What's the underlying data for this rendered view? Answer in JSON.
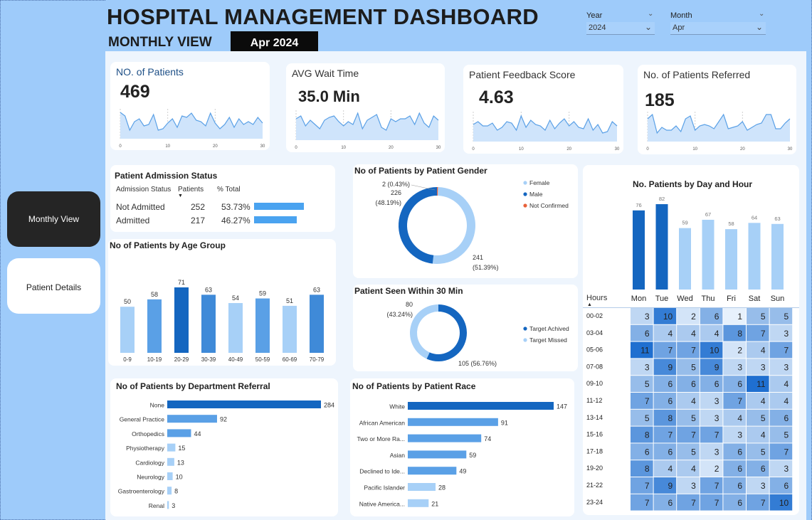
{
  "header": {
    "title": "HOSPITAL MANAGEMENT DASHBOARD",
    "subtitle": "MONTHLY VIEW",
    "selected_period": "Apr 2024"
  },
  "slicers": {
    "year": {
      "label": "Year",
      "value": "2024"
    },
    "month": {
      "label": "Month",
      "value": "Apr"
    }
  },
  "nav": {
    "monthly": "Monthly View",
    "patient": "Patient Details"
  },
  "kpis": [
    {
      "title": "NO. of Patients",
      "value": "469",
      "ticks": [
        "0",
        "10",
        "20",
        "30"
      ]
    },
    {
      "title": "AVG Wait Time",
      "value": "35.0 Min",
      "ticks": [
        "0",
        "10",
        "20",
        "30"
      ]
    },
    {
      "title": "Patient Feedback Score",
      "value": "4.63",
      "ticks": [
        "0",
        "10",
        "20",
        "30"
      ]
    },
    {
      "title": "No. of Patients Referred",
      "value": "185",
      "ticks": [
        "0",
        "10",
        "20",
        "30"
      ]
    }
  ],
  "admission": {
    "title": "Patient Admission Status",
    "headers": [
      "Admission Status",
      "Patients",
      "% Total"
    ],
    "rows": [
      {
        "status": "Not Admitted",
        "patients": "252",
        "pct": "53.73%",
        "share": 53.73
      },
      {
        "status": "Admitted",
        "patients": "217",
        "pct": "46.27%",
        "share": 46.27
      }
    ]
  },
  "colors": {
    "dark": "#1466c0",
    "mid": "#5aa0e6",
    "light": "#a7d0f7",
    "orange": "#e8613a",
    "heat_max": "#1f6fd0",
    "heat_min": "#e7f1fc"
  },
  "chart_data": [
    {
      "type": "bar",
      "title": "No of Patients by Age Group",
      "categories": [
        "0-9",
        "10-19",
        "20-29",
        "30-39",
        "40-49",
        "50-59",
        "60-69",
        "70-79"
      ],
      "values": [
        50,
        58,
        71,
        63,
        54,
        59,
        51,
        63
      ]
    },
    {
      "type": "pie",
      "title": "No of Patients by Patient Gender",
      "labels": [
        "Female",
        "Male",
        "Not Confirmed"
      ],
      "values": [
        241,
        226,
        2
      ],
      "data_labels": [
        "241\n(51.39%)",
        "226\n(48.19%)",
        "2 (0.43%)"
      ]
    },
    {
      "type": "pie",
      "title": "Patient Seen Within 30 Min",
      "labels": [
        "Target Achived",
        "Target Missed"
      ],
      "values": [
        105,
        80
      ],
      "data_labels": [
        "105 (56.76%)",
        "80\n(43.24%)"
      ]
    },
    {
      "type": "bar",
      "title": "No. Patients by Day and Hour",
      "categories": [
        "Mon",
        "Tue",
        "Wed",
        "Thu",
        "Fri",
        "Sat",
        "Sun"
      ],
      "values": [
        76,
        82,
        59,
        67,
        58,
        64,
        63
      ]
    },
    {
      "type": "heatmap",
      "row_header": "Hours",
      "rows": [
        "00-02",
        "03-04",
        "05-06",
        "07-08",
        "09-10",
        "11-12",
        "13-14",
        "15-16",
        "17-18",
        "19-20",
        "21-22",
        "23-24"
      ],
      "columns": [
        "Mon",
        "Tue",
        "Wed",
        "Thu",
        "Fri",
        "Sat",
        "Sun"
      ],
      "values": [
        [
          3,
          10,
          2,
          6,
          1,
          5,
          5
        ],
        [
          6,
          4,
          4,
          4,
          8,
          7,
          3
        ],
        [
          11,
          7,
          7,
          10,
          2,
          4,
          7
        ],
        [
          3,
          9,
          5,
          9,
          3,
          3,
          3
        ],
        [
          5,
          6,
          6,
          6,
          6,
          11,
          4
        ],
        [
          7,
          6,
          4,
          3,
          7,
          4,
          4
        ],
        [
          5,
          8,
          5,
          3,
          4,
          5,
          6
        ],
        [
          8,
          7,
          7,
          7,
          3,
          4,
          5
        ],
        [
          6,
          6,
          5,
          3,
          6,
          5,
          7
        ],
        [
          8,
          4,
          4,
          2,
          6,
          6,
          3
        ],
        [
          7,
          9,
          3,
          7,
          6,
          3,
          6
        ],
        [
          7,
          6,
          7,
          7,
          6,
          7,
          10
        ]
      ]
    },
    {
      "type": "bar",
      "orientation": "horizontal",
      "title": "No of Patients by Department Referral",
      "categories": [
        "None",
        "General Practice",
        "Orthopedics",
        "Physiotherapy",
        "Cardiology",
        "Neurology",
        "Gastroenterology",
        "Renal"
      ],
      "values": [
        284,
        92,
        44,
        15,
        13,
        10,
        8,
        3
      ]
    },
    {
      "type": "bar",
      "orientation": "horizontal",
      "title": "No of Patients by Patient Race",
      "categories": [
        "White",
        "African American",
        "Two or More Ra...",
        "Asian",
        "Declined to Ide...",
        "Pacific Islander",
        "Native America..."
      ],
      "values": [
        147,
        91,
        74,
        59,
        49,
        28,
        21
      ]
    }
  ]
}
